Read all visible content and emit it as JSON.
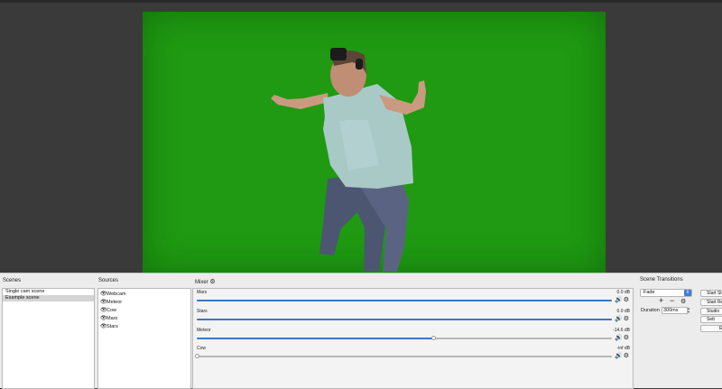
{
  "scenes": {
    "title": "Scenes",
    "items": [
      {
        "label": "Single cam scene",
        "selected": false
      },
      {
        "label": "Example scene",
        "selected": true
      }
    ]
  },
  "sources": {
    "title": "Sources",
    "items": [
      {
        "label": "Webcam",
        "icon": "eye-icon"
      },
      {
        "label": "Meteor",
        "icon": "eye-icon"
      },
      {
        "label": "Cow",
        "icon": "eye-icon"
      },
      {
        "label": "Mars",
        "icon": "eye-icon"
      },
      {
        "label": "Stars",
        "icon": "eye-icon"
      }
    ]
  },
  "mixer": {
    "title": "Mixer",
    "channels": [
      {
        "name": "Mars",
        "db": "0.0 dB",
        "level": 1.0
      },
      {
        "name": "Stars",
        "db": "0.0 dB",
        "level": 1.0
      },
      {
        "name": "Meteor",
        "db": "-14.6 dB",
        "level": 0.57
      },
      {
        "name": "Cow",
        "db": "-inf dB",
        "level": 0.0
      }
    ]
  },
  "transitions": {
    "title": "Scene Transitions",
    "selected": "Fade",
    "add_label": "+",
    "remove_label": "−",
    "duration_label": "Duration",
    "duration_value": "300ms"
  },
  "controls": {
    "buttons": [
      "Start St",
      "Start Re",
      "Studio",
      "Sett",
      "E"
    ]
  },
  "colors": {
    "chroma_green": "#1f9a12",
    "slider_blue": "#3a78c2",
    "select_blue": "#3d7de0"
  }
}
